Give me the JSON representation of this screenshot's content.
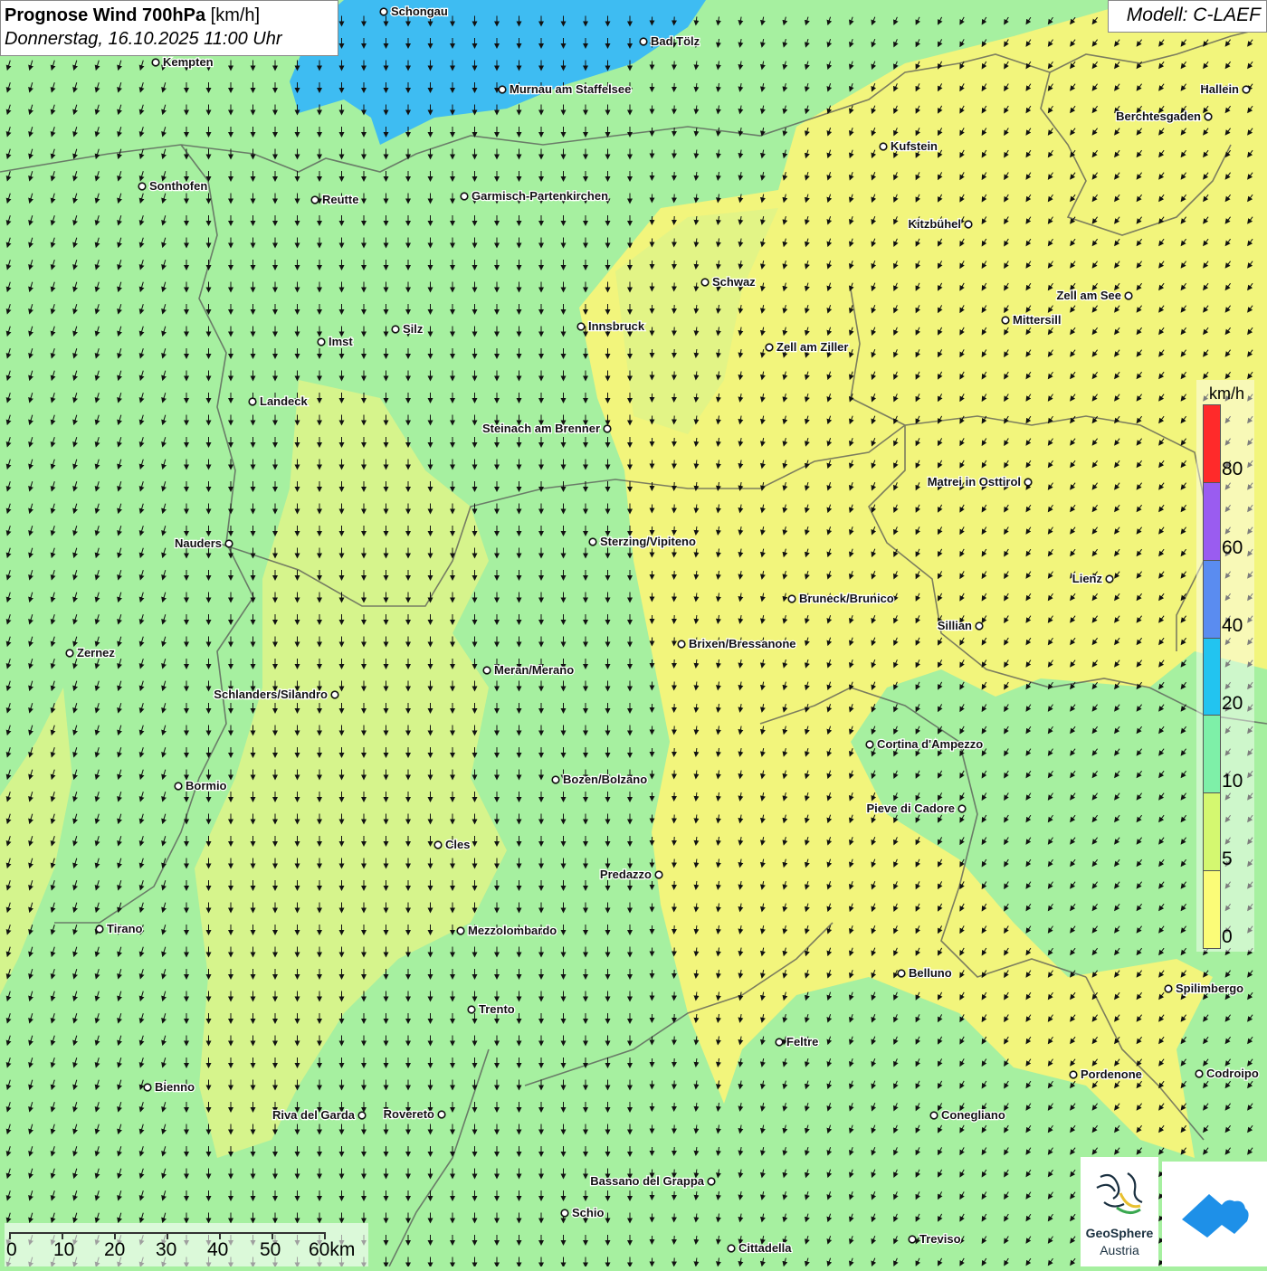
{
  "title": {
    "bold": "Prognose Wind 700hPa",
    "unit": "[km/h]",
    "datetime": "Donnerstag, 16.10.2025 11:00 Uhr"
  },
  "model": "Modell: C-LAEF",
  "legend": {
    "unit": "km/h",
    "labels": [
      "80",
      "60",
      "40",
      "20",
      "10",
      "5",
      "0"
    ],
    "colors": [
      "#ff2a2a",
      "#9a5cf0",
      "#5a8cf0",
      "#22c4f0",
      "#7ef0a8",
      "#d4f870",
      "#fbfc78"
    ]
  },
  "scalebar": {
    "labels": [
      "0",
      "10",
      "20",
      "30",
      "40",
      "50",
      "60km"
    ]
  },
  "logo": {
    "line1": "GeoSphere",
    "line2": "Austria"
  },
  "colors": {
    "lake": "#3ebcf2",
    "green_bg": "#a6f0a0",
    "yellow": "#f5f47a",
    "yellow_green": "#dcf48a",
    "border": "#555555"
  },
  "cities": [
    {
      "name": "Schongau"
    },
    {
      "name": "Bad Tölz"
    },
    {
      "name": "Kempten"
    },
    {
      "name": "Murnau am Staffelsee"
    },
    {
      "name": "Hallein"
    },
    {
      "name": "Berchtesgaden"
    },
    {
      "name": "Kufstein"
    },
    {
      "name": "Sonthofen"
    },
    {
      "name": "Reutte"
    },
    {
      "name": "Garmisch-Partenkirchen"
    },
    {
      "name": "Kitzbühel"
    },
    {
      "name": "Schwaz"
    },
    {
      "name": "Zell am See"
    },
    {
      "name": "Mittersill"
    },
    {
      "name": "Innsbruck"
    },
    {
      "name": "Silz"
    },
    {
      "name": "Imst"
    },
    {
      "name": "Zell am Ziller"
    },
    {
      "name": "Landeck"
    },
    {
      "name": "Steinach am Brenner"
    },
    {
      "name": "Matrei in Osttirol"
    },
    {
      "name": "Nauders"
    },
    {
      "name": "Sterzing/Vipiteno"
    },
    {
      "name": "Lienz"
    },
    {
      "name": "Bruneck/Brunico"
    },
    {
      "name": "Sillian"
    },
    {
      "name": "Brixen/Bressanone"
    },
    {
      "name": "Zernez"
    },
    {
      "name": "Meran/Merano"
    },
    {
      "name": "Schlanders/Silandro"
    },
    {
      "name": "Cortina d'Ampezzo"
    },
    {
      "name": "Bozen/Bolzano"
    },
    {
      "name": "Bormio"
    },
    {
      "name": "Pieve di Cadore"
    },
    {
      "name": "Cles"
    },
    {
      "name": "Predazzo"
    },
    {
      "name": "Tirano"
    },
    {
      "name": "Mezzolombardo"
    },
    {
      "name": "Belluno"
    },
    {
      "name": "Spilimbergo"
    },
    {
      "name": "Trento"
    },
    {
      "name": "Feltre"
    },
    {
      "name": "Pordenone"
    },
    {
      "name": "Codroipo"
    },
    {
      "name": "Bienno"
    },
    {
      "name": "Riva del Garda"
    },
    {
      "name": "Rovereto"
    },
    {
      "name": "Conegliano"
    },
    {
      "name": "Bassano del Grappa"
    },
    {
      "name": "Schio"
    },
    {
      "name": "Treviso"
    },
    {
      "name": "Cittadella"
    }
  ]
}
